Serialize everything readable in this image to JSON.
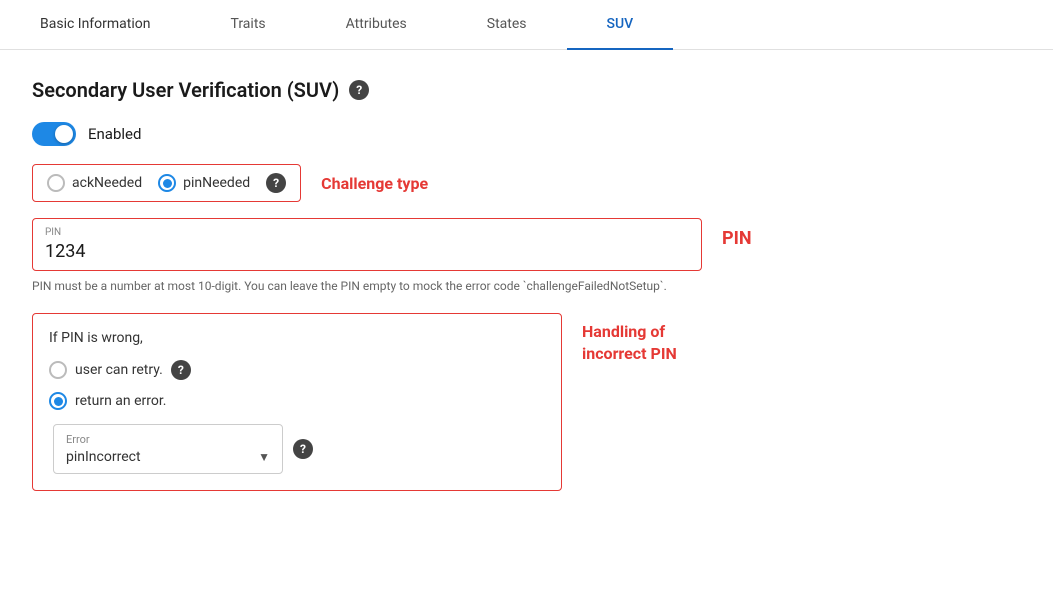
{
  "tabs": [
    {
      "id": "basic-information",
      "label": "Basic Information",
      "active": false
    },
    {
      "id": "traits",
      "label": "Traits",
      "active": false
    },
    {
      "id": "attributes",
      "label": "Attributes",
      "active": false
    },
    {
      "id": "states",
      "label": "States",
      "active": false
    },
    {
      "id": "suv",
      "label": "SUV",
      "active": true
    }
  ],
  "page": {
    "title": "Secondary User Verification (SUV)",
    "toggle_label": "Enabled",
    "challenge_type_label": "Challenge type",
    "challenge_options": [
      {
        "id": "ackNeeded",
        "label": "ackNeeded",
        "selected": false
      },
      {
        "id": "pinNeeded",
        "label": "pinNeeded",
        "selected": true
      }
    ],
    "pin_label": "PIN",
    "pin_field_label": "PIN",
    "pin_value": "1234",
    "pin_hint": "PIN must be a number at most 10-digit. You can leave the PIN empty to mock the error code `challengeFailedNotSetup`.",
    "incorrect_pin_title": "If PIN is wrong,",
    "retry_label": "user can retry.",
    "return_error_label": "return an error.",
    "error_field_label": "Error",
    "error_value": "pinIncorrect",
    "handling_label": "Handling of\nincorrect PIN"
  }
}
